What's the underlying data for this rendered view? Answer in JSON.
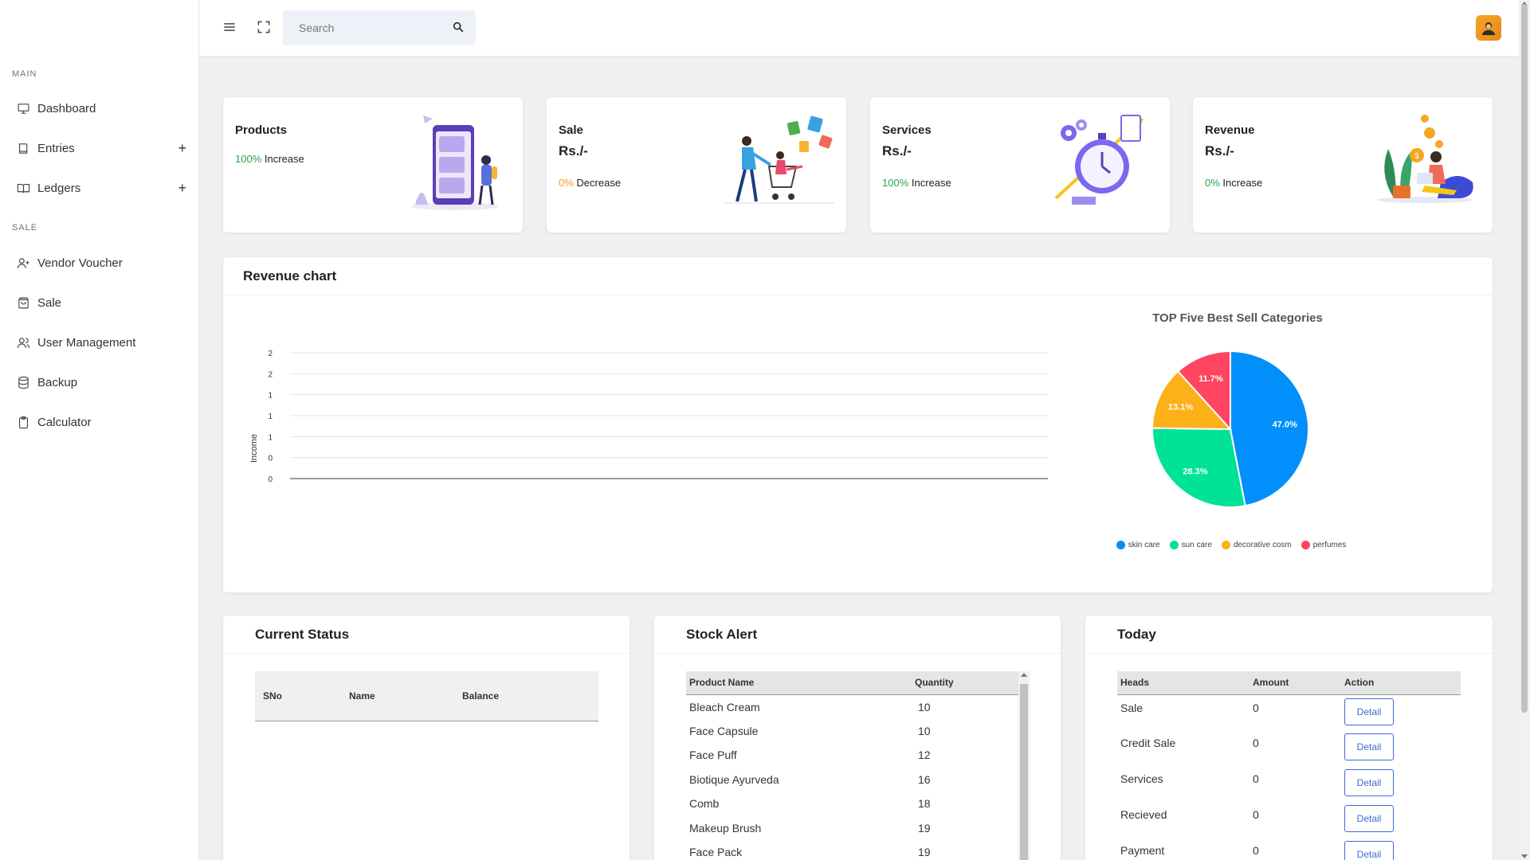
{
  "sidebar": {
    "sections": [
      "MAIN",
      "SALE"
    ],
    "items": [
      {
        "label": "Dashboard",
        "icon": "monitor-icon"
      },
      {
        "label": "Entries",
        "icon": "book-icon",
        "expandable": true
      },
      {
        "label": "Ledgers",
        "icon": "open-book-icon",
        "expandable": true
      },
      {
        "label": "Vendor Voucher",
        "icon": "user-plus-icon"
      },
      {
        "label": "Sale",
        "icon": "shopping-bag-icon"
      },
      {
        "label": "User Management",
        "icon": "users-icon"
      },
      {
        "label": "Backup",
        "icon": "database-icon"
      },
      {
        "label": "Calculator",
        "icon": "clipboard-icon"
      }
    ],
    "expand_symbol": "+"
  },
  "topbar": {
    "search_placeholder": "Search"
  },
  "stats": [
    {
      "title": "Products",
      "amount": "",
      "pct": "100%",
      "change": "Increase",
      "pct_color": "#28a745"
    },
    {
      "title": "Sale",
      "amount": "Rs./-",
      "pct": "0%",
      "change": "Decrease",
      "pct_color": "#f39c12"
    },
    {
      "title": "Services",
      "amount": "Rs./-",
      "pct": "100%",
      "change": "Increase",
      "pct_color": "#28a745"
    },
    {
      "title": "Revenue",
      "amount": "Rs./-",
      "pct": "0%",
      "change": "Increase",
      "pct_color": "#28a745"
    }
  ],
  "revenue": {
    "title": "Revenue chart"
  },
  "chart_data": [
    {
      "type": "line",
      "title": "",
      "xlabel": "",
      "ylabel": "Income",
      "y_tick_labels": [
        "2",
        "2",
        "1",
        "1",
        "1",
        "0",
        "0"
      ],
      "series": [],
      "grid": true
    },
    {
      "type": "pie",
      "title": "TOP Five Best Sell Categories",
      "labels": [
        "skin care",
        "sun care",
        "decorative cosm",
        "perfumes"
      ],
      "values": [
        47.0,
        28.3,
        13.1,
        11.7
      ],
      "value_labels": [
        "47.0%",
        "28.3%",
        "13.1%",
        "11.7%"
      ],
      "colors": [
        "#008ffb",
        "#00e396",
        "#feb019",
        "#ff4560"
      ],
      "legend": "bottom"
    }
  ],
  "current_status": {
    "title": "Current Status",
    "columns": [
      "SNo",
      "Name",
      "Balance"
    ]
  },
  "stock_alert": {
    "title": "Stock Alert",
    "columns": [
      "Product Name",
      "Quantity"
    ],
    "rows": [
      [
        "Bleach Cream",
        "10"
      ],
      [
        "Face Capsule",
        "10"
      ],
      [
        "Face Puff",
        "12"
      ],
      [
        "Biotique Ayurveda",
        "16"
      ],
      [
        "Comb",
        "18"
      ],
      [
        "Makeup Brush",
        "19"
      ],
      [
        "Face Pack",
        "19"
      ]
    ]
  },
  "today": {
    "title": "Today",
    "columns": [
      "Heads",
      "Amount",
      "Action"
    ],
    "button_label": "Detail",
    "rows": [
      [
        "Sale",
        "0"
      ],
      [
        "Credit Sale",
        "0"
      ],
      [
        "Services",
        "0"
      ],
      [
        "Recieved",
        "0"
      ],
      [
        "Payment",
        "0"
      ]
    ]
  }
}
